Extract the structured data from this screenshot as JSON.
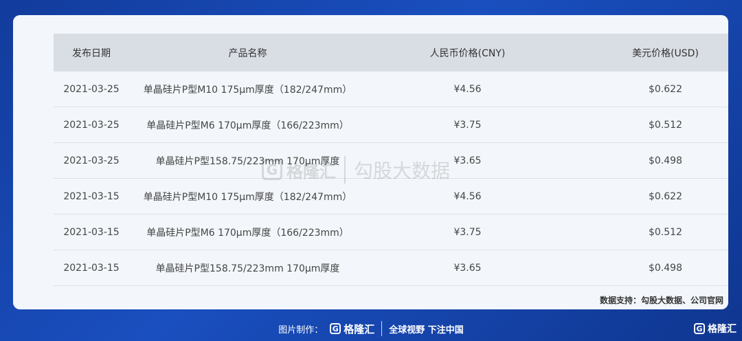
{
  "table": {
    "headers": [
      "发布日期",
      "产品名称",
      "人民币价格(CNY)",
      "美元价格(USD)"
    ],
    "rows": [
      [
        "2021-03-25",
        "单晶硅片P型M10 175μm厚度（182/247mm）",
        "¥4.56",
        "$0.622"
      ],
      [
        "2021-03-25",
        "单晶硅片P型M6 170μm厚度（166/223mm）",
        "¥3.75",
        "$0.512"
      ],
      [
        "2021-03-25",
        "单晶硅片P型158.75/223mm 170μm厚度",
        "¥3.65",
        "$0.498"
      ],
      [
        "2021-03-15",
        "单晶硅片P型M10 175μm厚度（182/247mm）",
        "¥4.56",
        "$0.622"
      ],
      [
        "2021-03-15",
        "单晶硅片P型M6 170μm厚度（166/223mm）",
        "¥3.75",
        "$0.512"
      ],
      [
        "2021-03-15",
        "单晶硅片P型158.75/223mm 170μm厚度",
        "¥3.65",
        "$0.498"
      ]
    ]
  },
  "source_note": "数据支持：勾股大数据、公司官网",
  "watermark": {
    "logo_letter": "G",
    "brand": "格隆汇",
    "text": "勾股大数据"
  },
  "footer": {
    "made_by": "图片制作：",
    "logo_letter": "G",
    "brand": "格隆汇",
    "slogan": "全球视野 下注中国"
  },
  "corner": {
    "logo_letter": "G",
    "brand": "格隆汇"
  },
  "colors": {
    "background": "#1a4fbf",
    "header_bg": "#d9dee4",
    "card_bg": "#f3f7fb"
  }
}
